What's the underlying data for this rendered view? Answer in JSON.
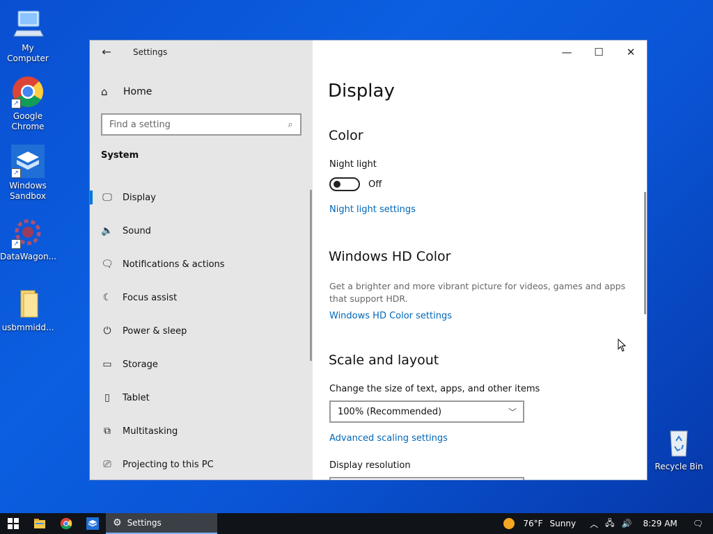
{
  "desktop": {
    "icons": [
      {
        "label": "My Computer",
        "icon": "computer-icon"
      },
      {
        "label": "Google Chrome",
        "icon": "chrome-icon"
      },
      {
        "label": "Windows Sandbox",
        "icon": "sandbox-icon"
      },
      {
        "label": "DataWagon...",
        "icon": "datawagon-icon"
      },
      {
        "label": "usbmmidd...",
        "icon": "folder-icon"
      },
      {
        "label": "Recycle Bin",
        "icon": "recycle-bin-icon"
      }
    ]
  },
  "window": {
    "title": "Settings",
    "caption": {
      "minimize": "—",
      "maximize": "☐",
      "close": "✕"
    }
  },
  "sidebar": {
    "home_label": "Home",
    "search_placeholder": "Find a setting",
    "section": "System",
    "items": [
      {
        "label": "Display",
        "icon": "monitor-icon",
        "active": true
      },
      {
        "label": "Sound",
        "icon": "speaker-icon"
      },
      {
        "label": "Notifications & actions",
        "icon": "notification-icon"
      },
      {
        "label": "Focus assist",
        "icon": "moon-icon"
      },
      {
        "label": "Power & sleep",
        "icon": "power-icon"
      },
      {
        "label": "Storage",
        "icon": "storage-icon"
      },
      {
        "label": "Tablet",
        "icon": "tablet-icon"
      },
      {
        "label": "Multitasking",
        "icon": "multitasking-icon"
      },
      {
        "label": "Projecting to this PC",
        "icon": "projecting-icon"
      }
    ]
  },
  "main": {
    "page_title": "Display",
    "color": {
      "heading": "Color",
      "night_light_label": "Night light",
      "night_light_state": "Off",
      "night_light_link": "Night light settings"
    },
    "hd_color": {
      "heading": "Windows HD Color",
      "description": "Get a brighter and more vibrant picture for videos, games and apps that support HDR.",
      "link": "Windows HD Color settings"
    },
    "scale": {
      "heading": "Scale and layout",
      "size_label": "Change the size of text, apps, and other items",
      "size_value": "100% (Recommended)",
      "advanced_link": "Advanced scaling settings",
      "resolution_label": "Display resolution"
    }
  },
  "taskbar": {
    "app_label": "Settings",
    "weather_temp": "76°F",
    "weather_desc": "Sunny",
    "time": "8:29 AM"
  }
}
